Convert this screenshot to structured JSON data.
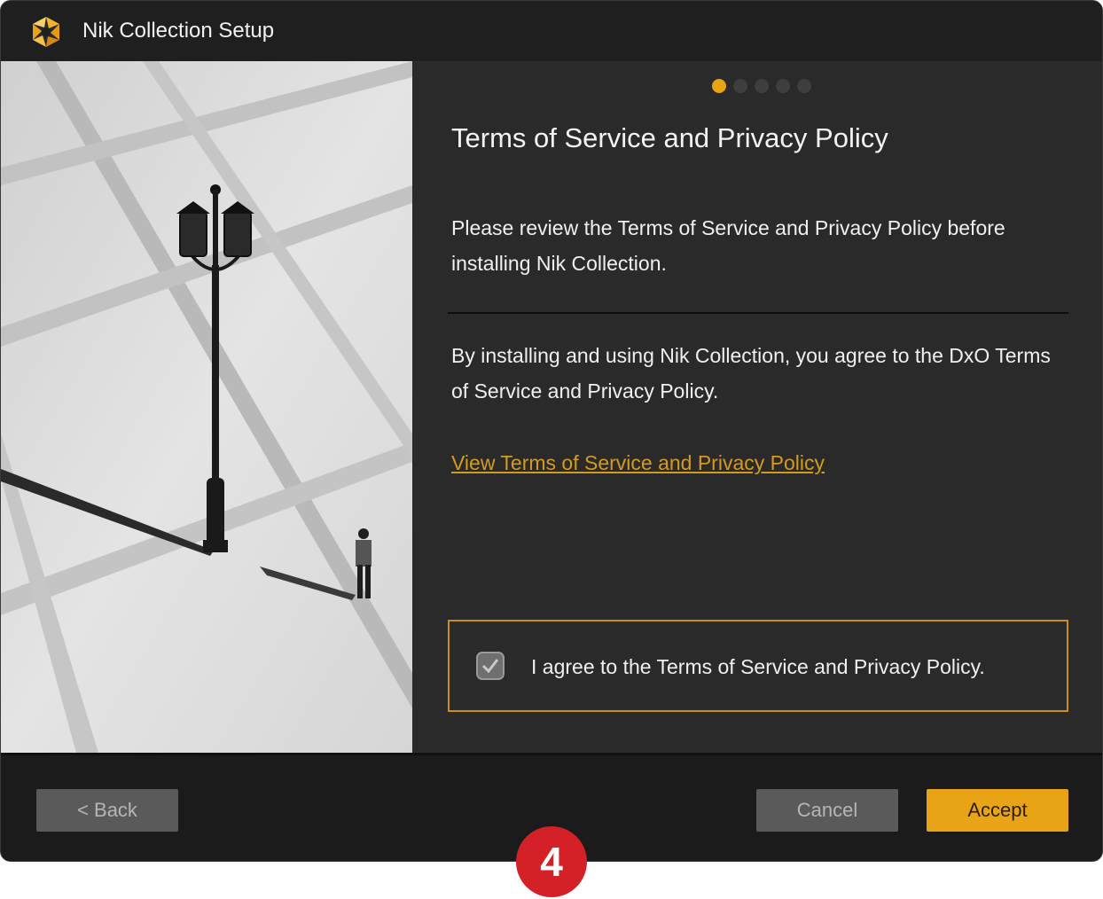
{
  "window": {
    "title": "Nik Collection Setup"
  },
  "progress": {
    "total_steps": 5,
    "current_step": 1
  },
  "content": {
    "heading": "Terms of Service and Privacy Policy",
    "intro": "Please review the Terms of Service and Privacy Policy before installing Nik Collection.",
    "agreement_text": "By installing and using Nik Collection, you agree to the DxO Terms of Service and Privacy Policy.",
    "link_text": "View Terms of Service and Privacy Policy",
    "checkbox_label": "I agree to the Terms of Service and Privacy Policy.",
    "checkbox_checked": true
  },
  "footer": {
    "back_label": "< Back",
    "cancel_label": "Cancel",
    "accept_label": "Accept"
  },
  "annotation": {
    "badge_number": "4"
  },
  "colors": {
    "accent": "#e8a317",
    "link": "#d49a1e",
    "badge": "#d42127"
  }
}
